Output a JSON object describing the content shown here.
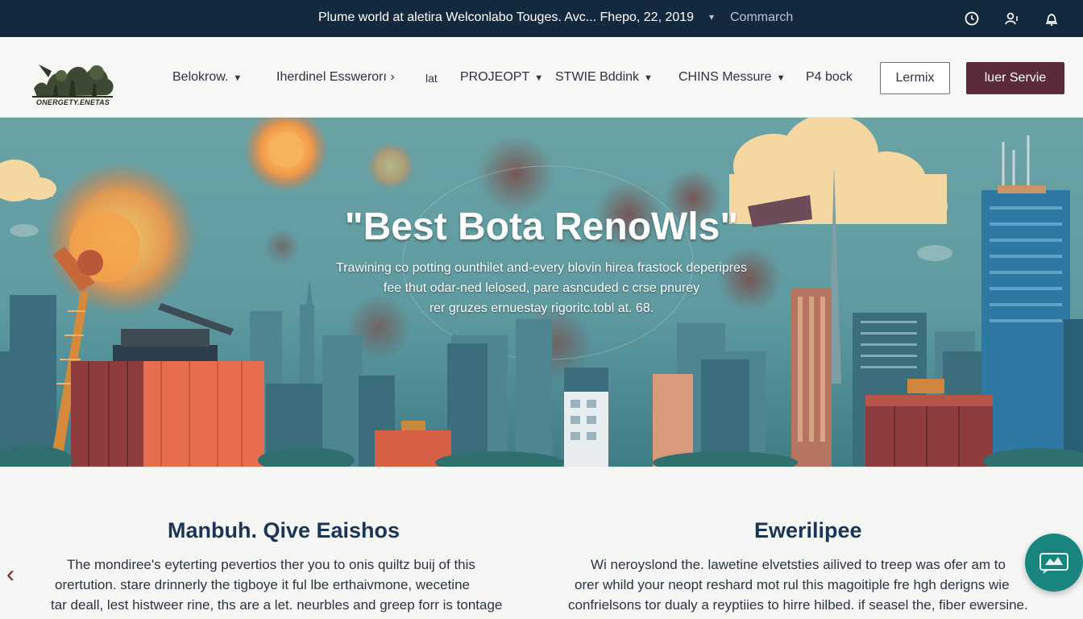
{
  "topbar": {
    "announcement": "Plume world at aletira Welconlabo Touges. Avc... Fhepo, 22, 2019",
    "link": "Commarch",
    "icons": [
      "clock-icon",
      "user-icon",
      "bell-icon"
    ]
  },
  "brand": {
    "logo_text": "ONERGETY.ENETAS"
  },
  "nav": {
    "items": [
      {
        "label": "Belokrow."
      },
      {
        "label": "Iherdinel Esswerorı ›"
      },
      {
        "label": "lat"
      },
      {
        "label": "PROJEOPT"
      },
      {
        "label": "STWIE  Bddink"
      },
      {
        "label": "CHINS Messure"
      },
      {
        "label": "P4 bock"
      }
    ],
    "outline_button": "Lermix",
    "solid_button": "luer Servie"
  },
  "hero": {
    "title": "\"Best Bota RenoWls\"",
    "lines": [
      "Trawining co potting ounthilet and-every blovin hirea frastock deperipres",
      "fee thut odar-ned lelosed, pare asncuded c crse pnurey",
      "rer gruzes ernuestay rigoritc.tobl at. 68."
    ]
  },
  "columns": [
    {
      "title": "Manbuh. Qive Eaishos",
      "lines": [
        "The mondiree's eyterting pevertios ther you to onis quiltz buij of this",
        "orertution. stare drinnerly the tigboye it ful lbe erthaivmone, wecetine",
        "tar deall, lest histweer rine, ths are a let. neurbles and greep forr is tontage"
      ]
    },
    {
      "title": "Ewerilipee",
      "lines": [
        "Wi neroyslond the. lawetine elvetsties ailived to treep was ofer am to",
        "orer whild your neopt reshard mot rul this magoitiple fre hgh derigns wie",
        "confrielsons tor dualy a reyptiies to hirre hilbed. if seasel the, fiber ewersine."
      ]
    }
  ],
  "colors": {
    "topbar": "#14293d",
    "accent": "#5b2b3c",
    "heading": "#1a3556",
    "fab": "#18867f"
  }
}
